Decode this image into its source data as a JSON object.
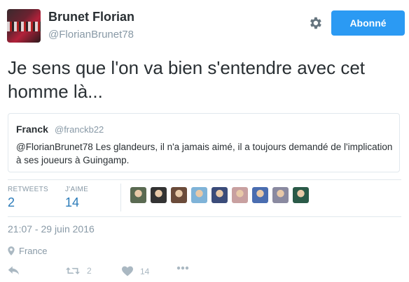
{
  "author": {
    "name": "Brunet Florian",
    "handle": "@FlorianBrunet78"
  },
  "follow_button": {
    "label": "Abonné",
    "color": "#2b9af3"
  },
  "tweet": {
    "text": "Je sens que l'on va bien s'entendre avec cet homme là..."
  },
  "quote": {
    "name": "Franck",
    "handle": "@franckb22",
    "text": "@FlorianBrunet78 Les glandeurs, il n'a jamais aimé, il a toujours demandé de l'implication à ses joueurs à Guingamp."
  },
  "stats": {
    "retweets_label": "RETWEETS",
    "retweets": "2",
    "likes_label": "J'AIME",
    "likes": "14"
  },
  "likers": [
    {
      "color": "#5a6a52"
    },
    {
      "color": "#333333"
    },
    {
      "color": "#6b4b3a"
    },
    {
      "color": "#7fb3d8"
    },
    {
      "color": "#3b4c7a"
    },
    {
      "color": "#c8a0a0"
    },
    {
      "color": "#4a6db0"
    },
    {
      "color": "#8a8aa0"
    },
    {
      "color": "#2a5a48"
    }
  ],
  "timestamp": "21:07 - 29 juin 2016",
  "location": "France",
  "actions": {
    "retweet_count": "2",
    "like_count": "14"
  }
}
